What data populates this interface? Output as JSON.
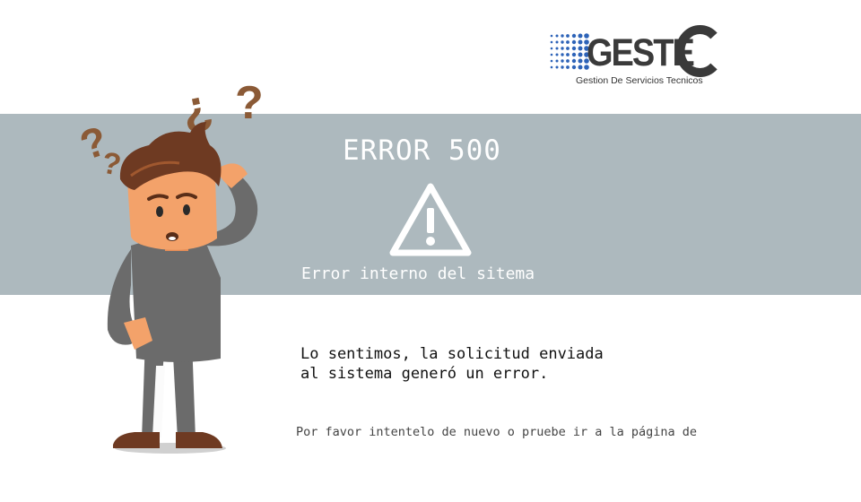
{
  "logo": {
    "wordmark": "GESTE",
    "letter_c": "C",
    "tagline": "Gestion De Servicios Tecnicos"
  },
  "error": {
    "title": "ERROR 500",
    "icon": "warning-triangle-icon",
    "subtitle": "Error interno del sitema"
  },
  "message": {
    "line1": "Lo sentimos, la solicitud enviada",
    "line2": "al sistema generó un error."
  },
  "hint": {
    "text": "Por favor intentelo de nuevo o pruebe ir a la página de"
  },
  "illustration": {
    "name": "confused-man-illustration",
    "question_marks": [
      "¿",
      "?",
      "?",
      "?"
    ]
  },
  "colors": {
    "band": "#adb9be",
    "question_mark": "#8b5a36",
    "sweater": "#6b6b6b",
    "skin": "#f3a26a",
    "hair": "#6e3a22",
    "logo_blue": "#2d63b8"
  }
}
